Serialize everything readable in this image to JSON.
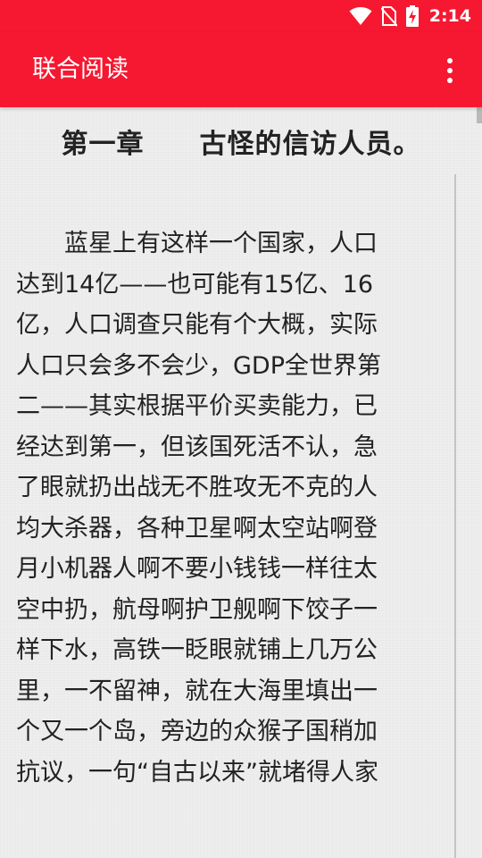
{
  "status_bar": {
    "time": "2:14",
    "icons": [
      "wifi-icon",
      "no-sim-icon",
      "battery-charging-icon"
    ],
    "color": "#ffffff"
  },
  "app_bar": {
    "title": "联合阅读",
    "menu_icon": "more-vert-icon",
    "background_color": "#f51830"
  },
  "reader": {
    "chapter_title": "第一章　　古怪的信访人员。",
    "lines": [
      "　　蓝星上有这样一个国家，人口",
      "达到14亿——也可能有15亿、16",
      "亿，人口调查只能有个大概，实际",
      "人口只会多不会少，GDP全世界第",
      "二——其实根据平价买卖能力，已",
      "经达到第一，但该国死活不认，急",
      "了眼就扔出战无不胜攻无不克的人",
      "均大杀器，各种卫星啊太空站啊登",
      "月小机器人啊不要小钱钱一样往太",
      "空中扔，航母啊护卫舰啊下饺子一",
      "样下水，高铁一眨眼就铺上几万公",
      "里，一不留神，就在大海里填出一",
      "个又一个岛，旁边的众猴子国稍加",
      "抗议，一句“自古以来”就堵得人家"
    ],
    "text_color": "#222222",
    "background_color": "#eeeeee"
  }
}
